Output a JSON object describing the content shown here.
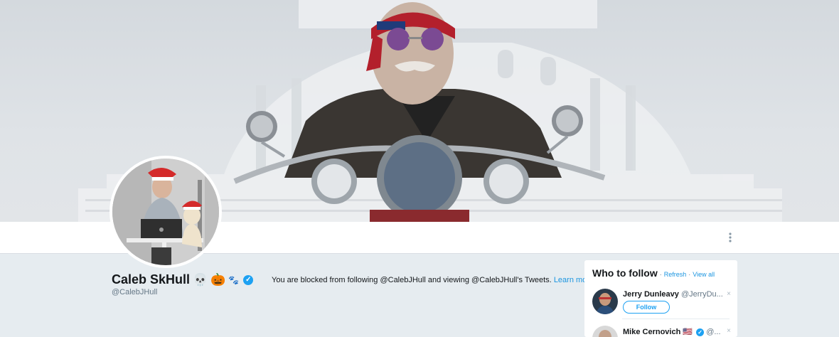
{
  "profile": {
    "name": "Caleb SkHull",
    "name_emojis": [
      "💀",
      "🎃",
      "🐾"
    ],
    "verified": true,
    "handle": "@CalebJHull"
  },
  "blocked_notice": {
    "text": "You are blocked from following @CalebJHull and viewing @CalebJHull's Tweets.",
    "link_label": "Learn more"
  },
  "who_to_follow": {
    "title": "Who to follow",
    "separator": "·",
    "refresh_label": "Refresh",
    "view_all_label": "View all",
    "items": [
      {
        "name": "Jerry Dunleavy",
        "handle": "@JerryDu...",
        "follow_label": "Follow",
        "dismiss": "×"
      },
      {
        "name": "Mike Cernovich",
        "flag": "🇺🇸",
        "verified": true,
        "handle": "@...",
        "dismiss": "×"
      }
    ]
  },
  "icons": {
    "more": "vertical-dots-icon",
    "verified": "verified-badge-icon",
    "dismiss": "close-icon"
  },
  "colors": {
    "accent": "#1da1f2",
    "link": "#1b95e0",
    "background": "#e6ecf0",
    "muted_text": "#657786"
  }
}
